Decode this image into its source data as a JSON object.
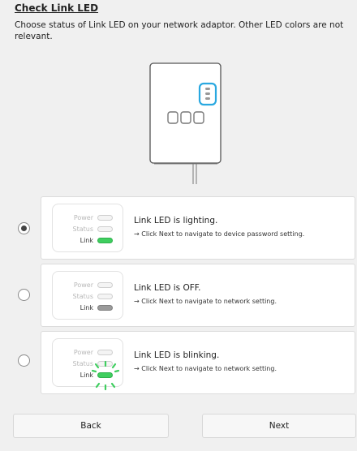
{
  "header": {
    "title": "Check Link LED",
    "description": "Choose status of Link LED on your network adaptor. Other LED colors are not relevant."
  },
  "colors": {
    "highlight": "#29a8e0",
    "led_green": "#3fce5f",
    "led_off": "#9a9a9a",
    "background": "#f0f0f0"
  },
  "led_labels": {
    "power": "Power",
    "status": "Status",
    "link": "Link"
  },
  "options": [
    {
      "selected": true,
      "title": "Link LED is lighting.",
      "subtitle": "→ Click Next to navigate to device password setting."
    },
    {
      "selected": false,
      "title": "Link LED is OFF.",
      "subtitle": "→ Click Next to navigate to network setting."
    },
    {
      "selected": false,
      "title": "Link LED is blinking.",
      "subtitle": "→ Click Next to navigate to network setting."
    }
  ],
  "buttons": {
    "back": "Back",
    "next": "Next"
  }
}
